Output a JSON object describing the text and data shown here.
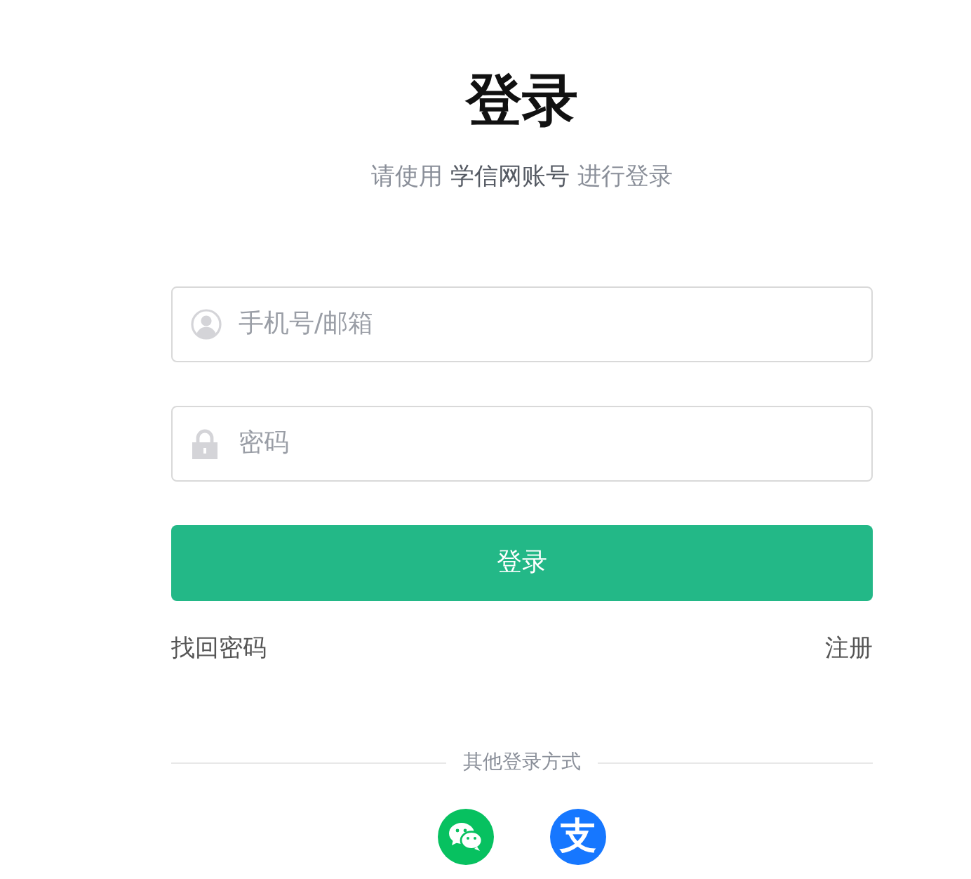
{
  "title": "登录",
  "subtitle": {
    "before": "请使用",
    "account": "学信网账号",
    "after": "进行登录"
  },
  "fields": [
    {
      "kind": "user",
      "placeholder": "手机号/邮箱"
    },
    {
      "kind": "lock",
      "placeholder": "密码"
    }
  ],
  "login_button": "登录",
  "links": [
    "找回密码",
    "注册"
  ],
  "other_methods": {
    "label": "其他登录方式",
    "methods": [
      {
        "kind": "wechat",
        "color": "#07c160"
      },
      {
        "kind": "alipay",
        "color": "#1677ff",
        "glyph": "支"
      }
    ]
  }
}
